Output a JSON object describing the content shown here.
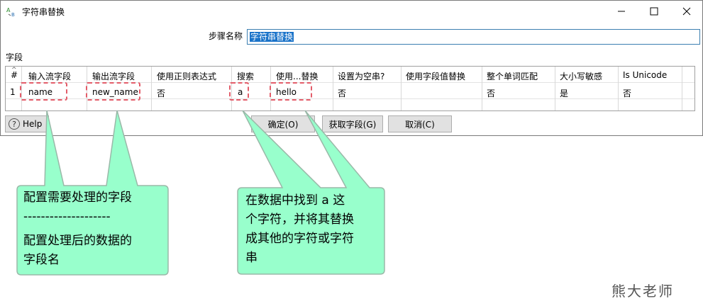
{
  "window": {
    "title": "字符串替换",
    "minimize_icon": "minimize-icon",
    "maximize_icon": "maximize-icon",
    "close_icon": "close-icon"
  },
  "form": {
    "step_name_label": "步骤名称",
    "step_name_value": "字符串替换"
  },
  "fields": {
    "label": "字段",
    "columns": [
      "#",
      "输入流字段",
      "输出流字段",
      "使用正则表达式",
      "搜索",
      "使用...替换",
      "设置为空串?",
      "使用字段值替换",
      "整个单词匹配",
      "大小写敏感",
      "Is Unicode"
    ],
    "rows": [
      {
        "index": "1",
        "input_field": "name",
        "output_field": "new_name",
        "use_regex": "否",
        "search": "a",
        "replace_with": "hello",
        "set_empty": "否",
        "replace_with_field": "",
        "whole_word": "否",
        "case_sensitive": "是",
        "is_unicode": "否"
      }
    ]
  },
  "buttons": {
    "help": "Help",
    "ok": "确定(O)",
    "get_fields": "获取字段(G)",
    "cancel": "取消(C)"
  },
  "annotations": {
    "left": [
      "配置需要处理的字段",
      "--------------------",
      "配置处理后的数据的",
      "字段名"
    ],
    "right": [
      "在数据中找到 a  这",
      "个字符，并将其替换",
      "成其他的字符或字符",
      "串"
    ]
  },
  "watermark": "熊大老师",
  "colors": {
    "callout_fill": "#98ffcc",
    "callout_border": "#9ab8a8",
    "dash_border": "#e35d6a",
    "selection": "#1a73c9"
  }
}
